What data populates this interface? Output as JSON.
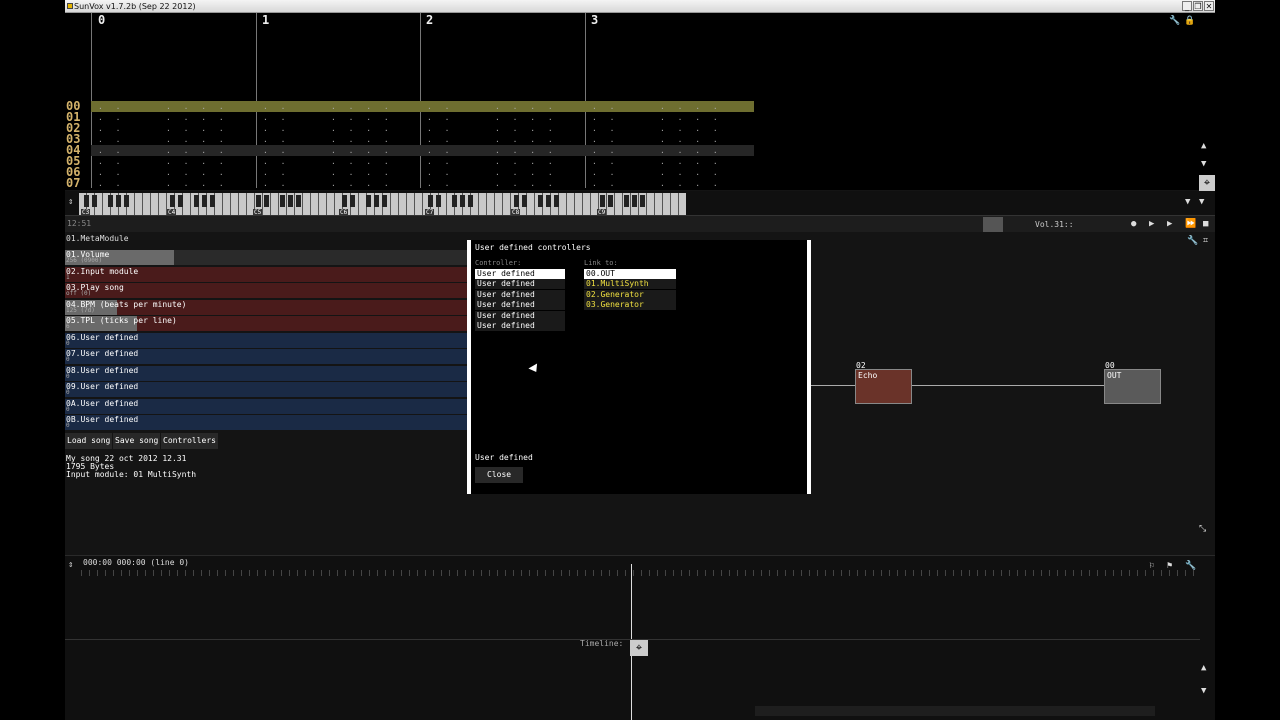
{
  "window": {
    "title": "SunVox v1.7.2b (Sep 22 2012)",
    "buttons": [
      "_",
      "❐",
      "✕"
    ]
  },
  "pattern": {
    "beats": [
      "0",
      "1",
      "2",
      "3"
    ],
    "lines": [
      "00",
      "01",
      "02",
      "03",
      "04",
      "05",
      "06",
      "07"
    ]
  },
  "piano": {
    "octaves": [
      "C3",
      "C4",
      "C5",
      "C6",
      "C7",
      "C8",
      "C9"
    ]
  },
  "status": {
    "time": "12:51",
    "volume": "Vol.31::"
  },
  "module_panel": {
    "module_name": "01.MetaModule",
    "controllers": [
      {
        "name": "01.Volume",
        "value": "256 (0900)",
        "color": "gray",
        "level": 0.27
      },
      {
        "name": "02.Input module",
        "value": "1",
        "color": "red",
        "level": 0
      },
      {
        "name": "03.Play song",
        "value": "off (0)",
        "color": "red",
        "level": 0
      },
      {
        "name": "04.BPM (beats per minute)",
        "value": "125 (7d)",
        "color": "red",
        "level": 0.13
      },
      {
        "name": "05.TPL (ticks per line)",
        "value": "6",
        "color": "red",
        "level": 0.18
      },
      {
        "name": "06.User defined",
        "value": "0",
        "color": "blue",
        "level": 0
      },
      {
        "name": "07.User defined",
        "value": "0",
        "color": "blue",
        "level": 0
      },
      {
        "name": "08.User defined",
        "value": "0",
        "color": "blue",
        "level": 0
      },
      {
        "name": "09.User defined",
        "value": "0",
        "color": "blue",
        "level": 0
      },
      {
        "name": "0A.User defined",
        "value": "0",
        "color": "blue",
        "level": 0
      },
      {
        "name": "0B.User defined",
        "value": "0",
        "color": "blue",
        "level": 0
      }
    ],
    "buttons": {
      "load": "Load song",
      "save": "Save song",
      "controllers": "Controllers"
    },
    "info": {
      "song": "My song 22 oct 2012 12.31",
      "size": "1795 Bytes",
      "input": "Input module: 01 MultiSynth"
    }
  },
  "dialog": {
    "title": "User defined controllers",
    "controller_label": "Controller:",
    "link_label": "Link to:",
    "controllers": [
      "User defined",
      "User defined",
      "User defined",
      "User defined",
      "User defined",
      "User defined"
    ],
    "links": [
      "00.OUT",
      "01.MultiSynth",
      "02.Generator",
      "03.Generator"
    ],
    "selected_name": "User defined",
    "close": "Close"
  },
  "modules": {
    "echo": {
      "id": "02",
      "name": "Echo",
      "color": "#6a3329"
    },
    "out": {
      "id": "00",
      "name": "OUT",
      "color": "#5a5a5a"
    }
  },
  "timeline": {
    "position": "000:00 000:00 (line 0)",
    "label": "Timeline:"
  },
  "colors": {
    "highlight_row": "#8a8a3a",
    "line_numbers": "#d3b26a",
    "link_text": "#f0e040"
  }
}
